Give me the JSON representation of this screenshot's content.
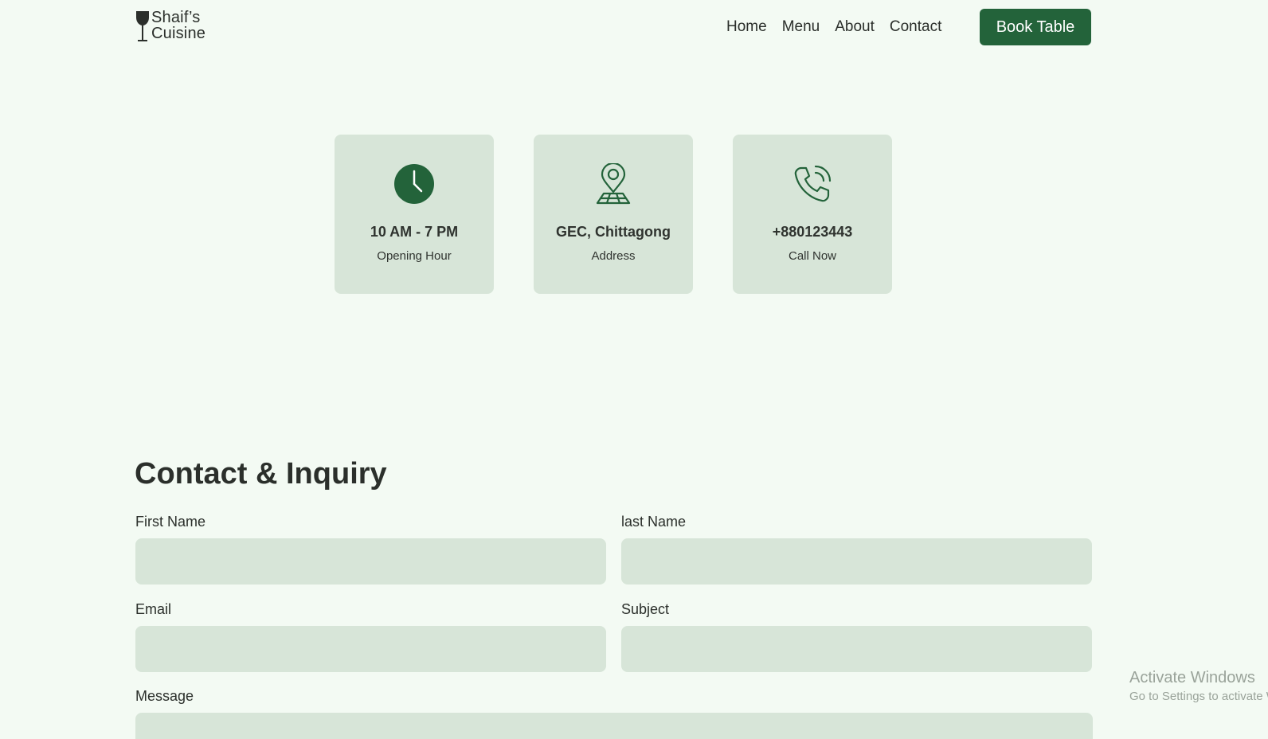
{
  "brand": {
    "name_line1": "Shaif’s",
    "name_line2": "Cuisine",
    "icon": "wine-glass-icon"
  },
  "nav": {
    "items": [
      {
        "label": "Home"
      },
      {
        "label": "Menu"
      },
      {
        "label": "About"
      },
      {
        "label": "Contact"
      }
    ],
    "cta_label": "Book Table"
  },
  "info_cards": [
    {
      "title": "10 AM - 7 PM",
      "subtitle": "Opening Hour",
      "icon": "clock-icon"
    },
    {
      "title": "GEC, Chittagong",
      "subtitle": "Address",
      "icon": "map-pin-icon"
    },
    {
      "title": "+880123443",
      "subtitle": "Call Now",
      "icon": "phone-icon"
    }
  ],
  "contact_form": {
    "title": "Contact & Inquiry",
    "first_name": {
      "label": "First Name",
      "value": "",
      "placeholder": ""
    },
    "last_name": {
      "label": "last Name",
      "value": "",
      "placeholder": ""
    },
    "email": {
      "label": "Email",
      "value": "",
      "placeholder": ""
    },
    "subject": {
      "label": "Subject",
      "value": "",
      "placeholder": ""
    },
    "message": {
      "label": "Message",
      "value": "",
      "placeholder": ""
    }
  },
  "os_watermark": {
    "line1": "Activate Windows",
    "line2": "Go to Settings to activate Windows."
  },
  "colors": {
    "background": "#f3faf3",
    "accent": "#23633a",
    "card_bg": "#d7e5d8",
    "text": "#2b2f2b"
  }
}
